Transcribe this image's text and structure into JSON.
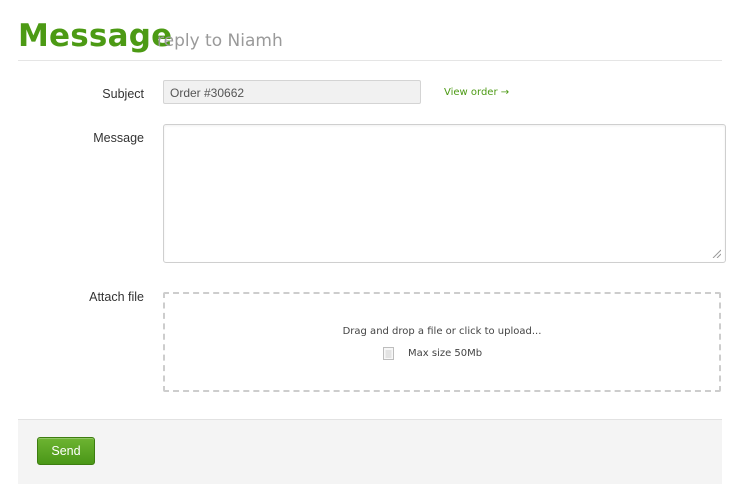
{
  "header": {
    "title": "Message",
    "subtitle": "reply to Niamh"
  },
  "form": {
    "subject": {
      "label": "Subject",
      "value": "Order #30662",
      "link_label": "View order →"
    },
    "message": {
      "label": "Message",
      "value": ""
    },
    "attach": {
      "label": "Attach file",
      "prompt": "Drag and drop a file or click to upload...",
      "max_size": "Max size 50Mb",
      "icon": "file-icon"
    }
  },
  "footer": {
    "send_label": "Send"
  },
  "colors": {
    "accent": "#4c9a14",
    "button": "#5aa523",
    "muted": "#9a9a9a"
  }
}
